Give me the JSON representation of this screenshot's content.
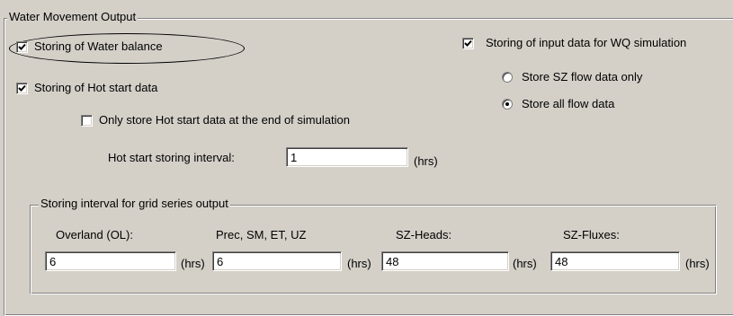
{
  "group_main": {
    "title": "Water Movement Output"
  },
  "options": {
    "water_balance": {
      "label": "Storing of Water balance",
      "checked": true
    },
    "hot_start": {
      "label": "Storing of Hot start data",
      "checked": true
    },
    "hot_start_end_only": {
      "label": "Only store Hot start data at the end of simulation",
      "checked": false
    },
    "wq_input": {
      "label": "Storing of input data for WQ simulation",
      "checked": true
    }
  },
  "flow_radios": [
    {
      "label": "Store SZ flow data only",
      "selected": false
    },
    {
      "label": "Store all flow data",
      "selected": true
    }
  ],
  "hot_start_interval": {
    "label": "Hot start storing interval:",
    "value": "1",
    "unit": "(hrs)"
  },
  "group_grid": {
    "title": "Storing interval for grid series output",
    "fields": [
      {
        "label": "Overland (OL):",
        "value": "6",
        "unit": "(hrs)"
      },
      {
        "label": "Prec, SM, ET, UZ",
        "value": "6",
        "unit": "(hrs)"
      },
      {
        "label": "SZ-Heads:",
        "value": "48",
        "unit": "(hrs)"
      },
      {
        "label": "SZ-Fluxes:",
        "value": "48",
        "unit": "(hrs)"
      }
    ]
  }
}
